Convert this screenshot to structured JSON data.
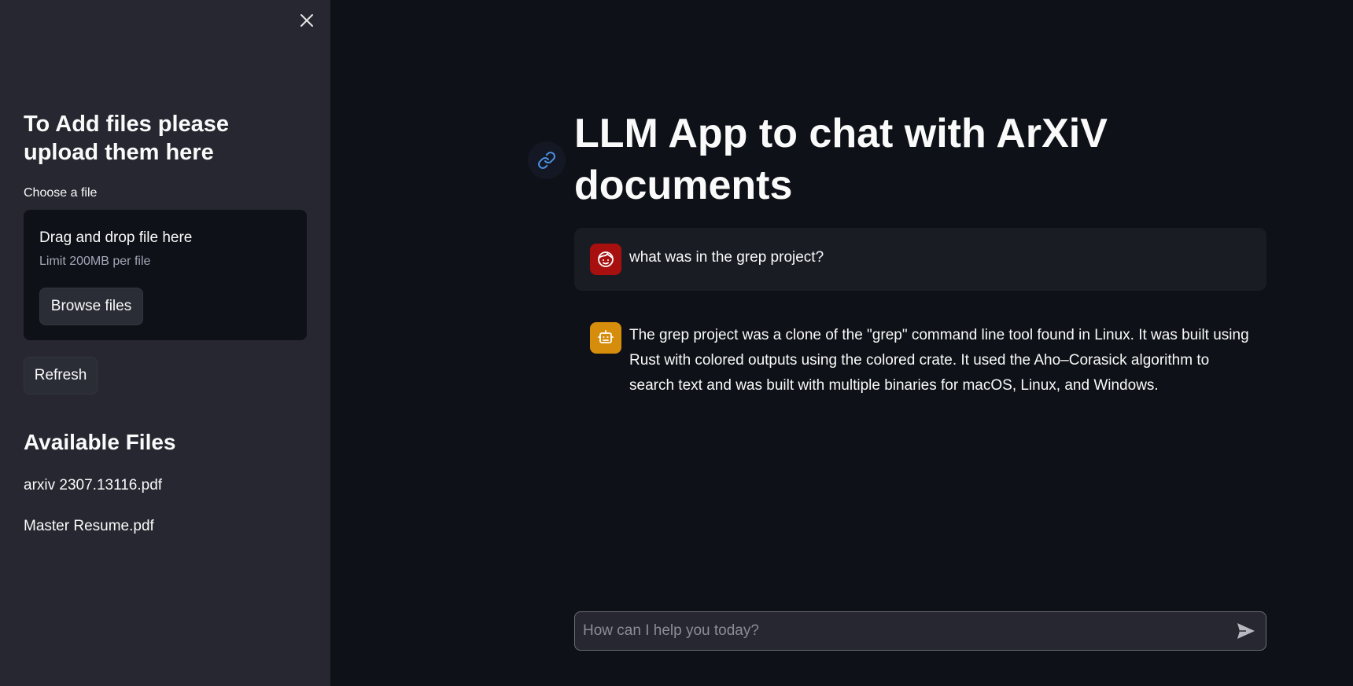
{
  "sidebar": {
    "close_icon": "close-icon",
    "heading": "To Add files please upload them here",
    "uploader_label": "Choose a file",
    "dropzone": {
      "title": "Drag and drop file here",
      "limit": "Limit 200MB per file",
      "browse_label": "Browse files"
    },
    "refresh_label": "Refresh",
    "available_heading": "Available Files",
    "files": [
      "arxiv 2307.13116.pdf",
      "Master Resume.pdf"
    ]
  },
  "main": {
    "link_icon": "link-icon",
    "title": "LLM App to chat with ArXiV documents",
    "messages": [
      {
        "role": "user",
        "avatar_icon": "user-face-icon",
        "avatar_color": "#a80f0f",
        "text": "what was in the grep project?"
      },
      {
        "role": "assistant",
        "avatar_icon": "robot-icon",
        "avatar_color": "#d68d0b",
        "text": "The grep project was a clone of the \"grep\" command line tool found in Linux. It was built using Rust with colored outputs using the colored crate. It used the Aho–Corasick algorithm to search text and was built with multiple binaries for macOS, Linux, and Windows."
      }
    ],
    "chat_input": {
      "placeholder": "How can I help you today?",
      "value": "",
      "send_icon": "send-icon"
    }
  },
  "colors": {
    "background": "#0e1117",
    "sidebar": "#262730",
    "user_avatar": "#a80f0f",
    "bot_avatar": "#d68d0b",
    "link_accent": "#4a90e2"
  }
}
